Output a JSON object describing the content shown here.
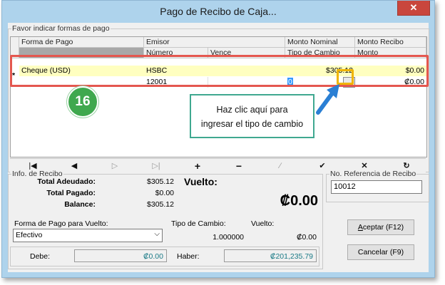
{
  "window": {
    "title": "Pago de Recibo de Caja...",
    "close_label": "✕"
  },
  "payments": {
    "group_label": "Favor indicar formas de pago",
    "headers_top": [
      "Forma de Pago",
      "Emisor",
      "Monto Nominal",
      "Monto Recibo"
    ],
    "headers_bottom": [
      "Número",
      "Vence",
      "Tipo de Cambio",
      "Monto"
    ],
    "row_indicator": "*",
    "row1": {
      "forma": "Cheque (USD)",
      "emisor": "HSBC",
      "monto_nominal": "$305.12",
      "monto_recibo": "$0.00"
    },
    "row2": {
      "numero": "12001",
      "vence": "",
      "tipo_cambio": "0",
      "ellipsis": "…",
      "monto": "₡0.00"
    }
  },
  "navigator": {
    "buttons": [
      {
        "name": "first-record-button",
        "glyph": "|◀"
      },
      {
        "name": "prior-record-button",
        "glyph": "◀"
      },
      {
        "name": "next-record-button",
        "glyph": "▷"
      },
      {
        "name": "last-record-button",
        "glyph": "▷|"
      },
      {
        "name": "insert-record-button",
        "glyph": "+"
      },
      {
        "name": "delete-record-button",
        "glyph": "−"
      },
      {
        "name": "edit-record-button",
        "glyph": "∕"
      },
      {
        "name": "post-record-button",
        "glyph": "✔"
      },
      {
        "name": "cancel-record-button",
        "glyph": "✕"
      },
      {
        "name": "refresh-records-button",
        "glyph": "↻"
      }
    ]
  },
  "receipt_info": {
    "group_label": "Info. de Recibo",
    "total_adeudado_label": "Total Adeudado:",
    "total_adeudado": "$305.12",
    "total_pagado_label": "Total Pagado:",
    "total_pagado": "$0.00",
    "balance_label": "Balance:",
    "balance": "$305.12",
    "vuelto_label": "Vuelto:",
    "vuelto_big": "₡0.00",
    "forma_pago_vuelto_label": "Forma de Pago para Vuelto:",
    "forma_pago_vuelto": "Efectivo",
    "tipo_cambio_label": "Tipo de Cambio:",
    "tipo_cambio": "1.000000",
    "vuelto_small_label": "Vuelto:",
    "vuelto_small": "₡0.00",
    "debe_label": "Debe:",
    "debe": "₡0.00",
    "haber_label": "Haber:",
    "haber": "₡201,235.79"
  },
  "reference": {
    "label": "No. Referencia de Recibo",
    "value": "10012"
  },
  "actions": {
    "accept_prefix": "A",
    "accept_rest": "ceptar (F12)",
    "cancel": "Cancelar (F9)"
  },
  "annotation": {
    "step_number": "16",
    "tooltip_line1": "Haz clic aquí para",
    "tooltip_line2": "ingresar el tipo de cambio"
  },
  "colors": {
    "highlight": "#e4574f",
    "badge": "#3fa84e",
    "tooltip_border": "#3fa890",
    "arrow": "#2a7fd4",
    "selected_row": "#ffffc0"
  }
}
